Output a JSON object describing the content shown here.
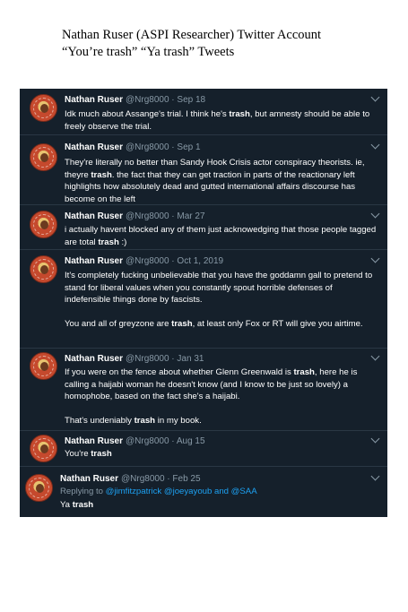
{
  "title": {
    "line1": "Nathan Ruser (ASPI Researcher) Twitter Account",
    "line2": "“You’re trash” “Ya trash” Tweets"
  },
  "tweets": [
    {
      "name": "Nathan Ruser",
      "meta": "@Nrg8000 · Sep 18",
      "paras": [
        [
          [
            "Idk much about Assange's trial. I think he's ",
            false
          ],
          [
            "trash",
            true
          ],
          [
            ", but amnesty should be able to freely observe the trial.",
            false
          ]
        ]
      ]
    },
    {
      "name": "Nathan Ruser",
      "meta": "@Nrg8000 · Sep 1",
      "paras": [
        [
          [
            "They're literally no better than Sandy Hook Crisis actor conspiracy theorists. ie, theyre ",
            false
          ],
          [
            "trash",
            true
          ],
          [
            ". the fact that they can get traction in parts of the reactionary left highlights how absolutely dead and gutted international affairs discourse has become on the left",
            false
          ]
        ]
      ]
    },
    {
      "name": "Nathan Ruser",
      "meta": "@Nrg8000 · Mar 27",
      "paras": [
        [
          [
            "i actually havent blocked any of them just acknowedging that those people tagged are total ",
            false
          ],
          [
            "trash",
            true
          ],
          [
            " :)",
            false
          ]
        ]
      ]
    },
    {
      "name": "Nathan Ruser",
      "meta": "@Nrg8000 · Oct 1, 2019",
      "paras": [
        [
          [
            "It's completely fucking unbelievable that you have the goddamn gall to pretend to stand for liberal values when you constantly spout horrible defenses of indefensible things done by fascists.",
            false
          ]
        ],
        [
          [
            "You and all of greyzone are ",
            false
          ],
          [
            "trash",
            true
          ],
          [
            ", at least only Fox or RT will give you airtime.",
            false
          ]
        ]
      ]
    },
    {
      "name": "Nathan Ruser",
      "meta": "@Nrg8000 · Jan 31",
      "paras": [
        [
          [
            "If you were on the fence about whether Glenn Greenwald is ",
            false
          ],
          [
            "trash",
            true
          ],
          [
            ", here he is calling a haijabi woman he doesn't know (and I know to be just so lovely) a homophobe, based on the fact she's a haijabi.",
            false
          ]
        ],
        [
          [
            "That's undeniably ",
            false
          ],
          [
            "trash",
            true
          ],
          [
            " in my book.",
            false
          ]
        ]
      ]
    },
    {
      "name": "Nathan Ruser",
      "meta": "@Nrg8000 · Aug 15",
      "paras": [
        [
          [
            "You're ",
            false
          ],
          [
            "trash",
            true
          ]
        ]
      ]
    },
    {
      "name": "Nathan Ruser",
      "meta": "@Nrg8000 · Feb 25",
      "reply": {
        "prefix": "Replying to ",
        "handles": "@jimfitzpatrick @joeyayoub and @SAA"
      },
      "paras": [
        [
          [
            "Ya ",
            false
          ],
          [
            "trash",
            true
          ]
        ]
      ]
    }
  ]
}
